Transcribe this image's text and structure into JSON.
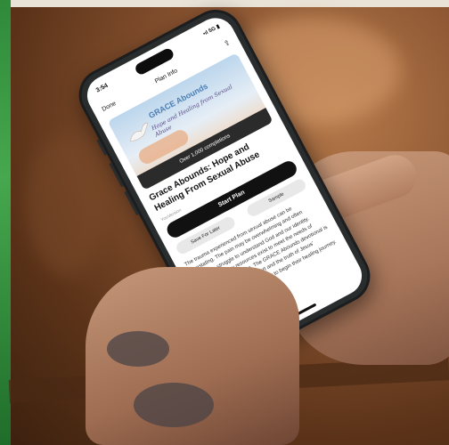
{
  "status_bar": {
    "time": "3:54",
    "icons": "•ıl 5G ▮"
  },
  "nav": {
    "done": "Done",
    "title": "Plan Info",
    "share_icon": "share-icon"
  },
  "banner": {
    "title": "GRACE Abounds",
    "subtitle": "Hope and Healing from Sexual Abuse",
    "completions": "Over 1,000 completions"
  },
  "plan": {
    "title": "Grace Abounds: Hope and Healing From Sexual Abuse",
    "byline": "YouVersion",
    "start_label": "Start Plan",
    "save_label": "Save For Later",
    "sample_label": "Sample",
    "description": "The trauma experienced from sexual abuse can be devastating. The pain may be overwhelming and often results in a struggle to understand God and our identity. Unfortunately, few resources exist to meet the needs of victims of sexual trauma. The GRACE Abounds devotional is a resource that offers support and the truth of Jesus' abundant love to women ready to begin their healing journey."
  },
  "colors": {
    "phone_frame": "#1b1d1e",
    "primary_button": "#111111",
    "banner_title": "#4a7fb6"
  }
}
